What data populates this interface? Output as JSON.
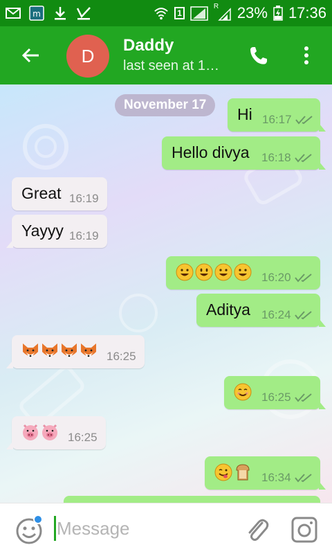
{
  "status_bar": {
    "icons_left": [
      "mail-icon",
      "app-notification-icon",
      "download-icon",
      "check-icon"
    ],
    "sim_label": "1",
    "roaming_label": "R",
    "battery_percent": "23%",
    "time": "17:36"
  },
  "header": {
    "avatar_letter": "D",
    "avatar_color": "#e06150",
    "contact_name": "Daddy",
    "contact_status": "last seen at 1…",
    "accent_color": "#22a722"
  },
  "chat": {
    "date_label": "November 17",
    "messages": [
      {
        "dir": "out",
        "text": "Hi",
        "time": "16:17",
        "read": true
      },
      {
        "dir": "out",
        "text": "Hello divya",
        "time": "16:18",
        "read": true
      },
      {
        "dir": "in",
        "text": "Great",
        "time": "16:19"
      },
      {
        "dir": "in",
        "text": "Yayyy",
        "time": "16:19"
      },
      {
        "dir": "out",
        "emoji": [
          "grinning-face-emoji",
          "smiley-face-emoji",
          "grinning-face-emoji",
          "grinning-face-emoji"
        ],
        "time": "16:20",
        "read": true
      },
      {
        "dir": "out",
        "text": "Aditya",
        "time": "16:24",
        "read": true
      },
      {
        "dir": "in",
        "emoji": [
          "fox-face-emoji",
          "fox-face-emoji",
          "fox-face-emoji",
          "fox-face-emoji"
        ],
        "time": "16:25"
      },
      {
        "dir": "out",
        "emoji": [
          "smiling-face-emoji"
        ],
        "time": "16:25",
        "read": true
      },
      {
        "dir": "in",
        "emoji": [
          "pig-face-emoji",
          "pig-face-emoji"
        ],
        "time": "16:25"
      },
      {
        "dir": "out",
        "emoji": [
          "yum-face-emoji",
          "bread-emoji"
        ],
        "time": "16:34",
        "read": true
      }
    ]
  },
  "composer": {
    "placeholder": "Message"
  }
}
